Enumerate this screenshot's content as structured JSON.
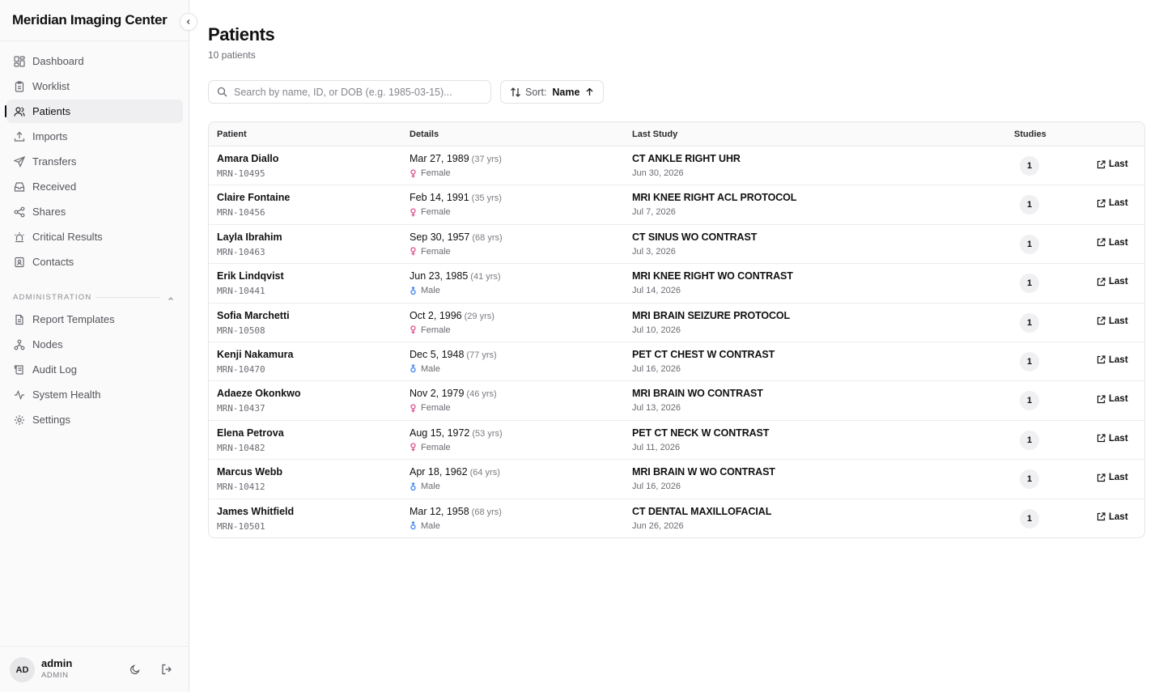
{
  "app": {
    "title": "Meridian Imaging Center"
  },
  "nav": {
    "items": [
      {
        "label": "Dashboard",
        "icon": "dashboard-icon",
        "active": false
      },
      {
        "label": "Worklist",
        "icon": "clipboard-icon",
        "active": false
      },
      {
        "label": "Patients",
        "icon": "users-icon",
        "active": true
      },
      {
        "label": "Imports",
        "icon": "upload-icon",
        "active": false
      },
      {
        "label": "Transfers",
        "icon": "send-icon",
        "active": false
      },
      {
        "label": "Received",
        "icon": "inbox-icon",
        "active": false
      },
      {
        "label": "Shares",
        "icon": "share-icon",
        "active": false
      },
      {
        "label": "Critical Results",
        "icon": "siren-icon",
        "active": false
      },
      {
        "label": "Contacts",
        "icon": "contact-book-icon",
        "active": false
      }
    ],
    "admin_label": "ADMINISTRATION",
    "admin_items": [
      {
        "label": "Report Templates",
        "icon": "file-text-icon"
      },
      {
        "label": "Nodes",
        "icon": "network-icon"
      },
      {
        "label": "Audit Log",
        "icon": "scroll-icon"
      },
      {
        "label": "System Health",
        "icon": "activity-icon"
      },
      {
        "label": "Settings",
        "icon": "gear-icon"
      }
    ]
  },
  "user": {
    "initials": "AD",
    "name": "admin",
    "role": "ADMIN"
  },
  "page": {
    "title": "Patients",
    "subtitle": "10 patients",
    "search_placeholder": "Search by name, ID, or DOB (e.g. 1985-03-15)...",
    "sort_label": "Sort:",
    "sort_value": "Name"
  },
  "table": {
    "headers": {
      "patient": "Patient",
      "details": "Details",
      "last_study": "Last Study",
      "studies": "Studies"
    },
    "action_label": "Last",
    "rows": [
      {
        "name": "Amara Diallo",
        "mrn": "MRN-10495",
        "dob": "Mar 27, 1989",
        "age": "(37 yrs)",
        "sex": "Female",
        "study": "CT ANKLE RIGHT UHR",
        "study_date": "Jun 30, 2026",
        "count": "1"
      },
      {
        "name": "Claire Fontaine",
        "mrn": "MRN-10456",
        "dob": "Feb 14, 1991",
        "age": "(35 yrs)",
        "sex": "Female",
        "study": "MRI KNEE RIGHT ACL PROTOCOL",
        "study_date": "Jul 7, 2026",
        "count": "1"
      },
      {
        "name": "Layla Ibrahim",
        "mrn": "MRN-10463",
        "dob": "Sep 30, 1957",
        "age": "(68 yrs)",
        "sex": "Female",
        "study": "CT SINUS WO CONTRAST",
        "study_date": "Jul 3, 2026",
        "count": "1"
      },
      {
        "name": "Erik Lindqvist",
        "mrn": "MRN-10441",
        "dob": "Jun 23, 1985",
        "age": "(41 yrs)",
        "sex": "Male",
        "study": "MRI KNEE RIGHT WO CONTRAST",
        "study_date": "Jul 14, 2026",
        "count": "1"
      },
      {
        "name": "Sofia Marchetti",
        "mrn": "MRN-10508",
        "dob": "Oct 2, 1996",
        "age": "(29 yrs)",
        "sex": "Female",
        "study": "MRI BRAIN SEIZURE PROTOCOL",
        "study_date": "Jul 10, 2026",
        "count": "1"
      },
      {
        "name": "Kenji Nakamura",
        "mrn": "MRN-10470",
        "dob": "Dec 5, 1948",
        "age": "(77 yrs)",
        "sex": "Male",
        "study": "PET CT CHEST W CONTRAST",
        "study_date": "Jul 16, 2026",
        "count": "1"
      },
      {
        "name": "Adaeze Okonkwo",
        "mrn": "MRN-10437",
        "dob": "Nov 2, 1979",
        "age": "(46 yrs)",
        "sex": "Female",
        "study": "MRI BRAIN WO CONTRAST",
        "study_date": "Jul 13, 2026",
        "count": "1"
      },
      {
        "name": "Elena Petrova",
        "mrn": "MRN-10482",
        "dob": "Aug 15, 1972",
        "age": "(53 yrs)",
        "sex": "Female",
        "study": "PET CT NECK W CONTRAST",
        "study_date": "Jul 11, 2026",
        "count": "1"
      },
      {
        "name": "Marcus Webb",
        "mrn": "MRN-10412",
        "dob": "Apr 18, 1962",
        "age": "(64 yrs)",
        "sex": "Male",
        "study": "MRI BRAIN W WO CONTRAST",
        "study_date": "Jul 16, 2026",
        "count": "1"
      },
      {
        "name": "James Whitfield",
        "mrn": "MRN-10501",
        "dob": "Mar 12, 1958",
        "age": "(68 yrs)",
        "sex": "Male",
        "study": "CT DENTAL MAXILLOFACIAL",
        "study_date": "Jun 26, 2026",
        "count": "1"
      }
    ]
  },
  "colors": {
    "female": "#e0508f",
    "male": "#3b82f6",
    "accent": "#111111"
  }
}
